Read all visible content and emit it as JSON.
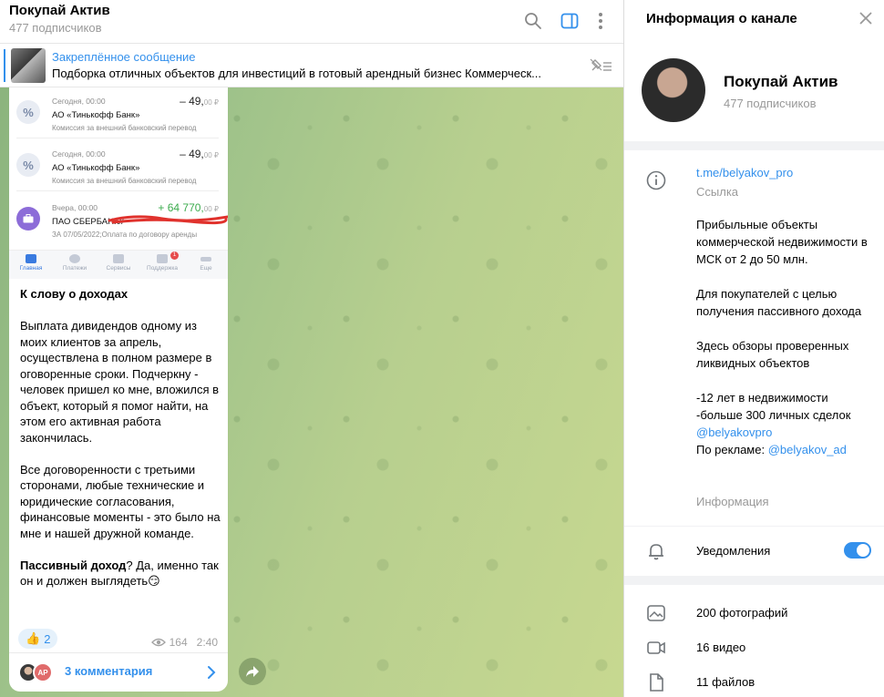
{
  "chat": {
    "title": "Покупай Актив",
    "subscribers": "477 подписчиков"
  },
  "pinned": {
    "title": "Закреплённое сообщение",
    "text": "Подборка отличных объектов для инвестиций в готовый арендный бизнес  Коммерческ..."
  },
  "screenshot": {
    "transactions": [
      {
        "date": "Сегодня, 00:00",
        "name": "АО «Тинькофф Банк»",
        "note": "Комиссия за внешний банковский перевод",
        "amount": "– 49,",
        "cents": "00 ₽",
        "icon": "%"
      },
      {
        "date": "Сегодня, 00:00",
        "name": "АО «Тинькофф Банк»",
        "note": "Комиссия за внешний банковский перевод",
        "amount": "– 49,",
        "cents": "00 ₽",
        "icon": "%"
      },
      {
        "date": "Вчера, 00:00",
        "name": "ПАО СБЕРБАНК//",
        "note": "ЗА 07/05/2022;Оплата по договору аренды",
        "amount": "+ 64 770,",
        "cents": "00 ₽",
        "icon": "bank"
      }
    ],
    "tabs": [
      "Главная",
      "Платежи",
      "Сервисы",
      "Поддержка",
      "Еще"
    ],
    "badge": "1"
  },
  "message": {
    "heading": "К слову о доходах",
    "p1": "Выплата дивидендов одному из моих клиентов за апрель, осуществлена в полном размере в оговоренные сроки. Подчеркну - человек пришел ко мне, вложился в объект, который я помог найти, на этом его активная работа закончилась.",
    "p2": "Все договоренности с третьими сторонами, любые технические и юридические согласования, финансовые моменты - это было на мне и нашей дружной команде.",
    "p3_bold": "Пассивный доход",
    "p3_rest": "? Да, именно так он и должен выглядеть😏",
    "reaction_emoji": "👍",
    "reaction_count": "2",
    "views": "164",
    "time": "2:40",
    "comments": "3 комментария",
    "avatar2_initials": "AP"
  },
  "info": {
    "title": "Информация о канале",
    "name": "Покупай Актив",
    "subscribers": "477 подписчиков",
    "link": "t.me/belyakov_pro",
    "link_caption": "Ссылка",
    "desc_p1": "Прибыльные объекты коммерческой недвижимости в МСК от 2 до 50 млн.",
    "desc_p2": "Для покупателей с целью получения пассивного дохода",
    "desc_p3": "Здесь обзоры проверенных ликвидных объектов",
    "desc_l1": "-12 лет в недвижимости",
    "desc_l2": "-больше 300 личных сделок",
    "desc_l3": "@belyakovpro",
    "desc_l4_prefix": "По рекламе: ",
    "desc_l4_link": "@belyakov_ad",
    "desc_caption": "Информация",
    "notifications": "Уведомления",
    "notifications_on": true,
    "media": {
      "photos": "200 фотографий",
      "videos": "16 видео",
      "files": "11 файлов"
    }
  },
  "colors": {
    "accent": "#3390ec",
    "positive": "#3bab4d"
  }
}
